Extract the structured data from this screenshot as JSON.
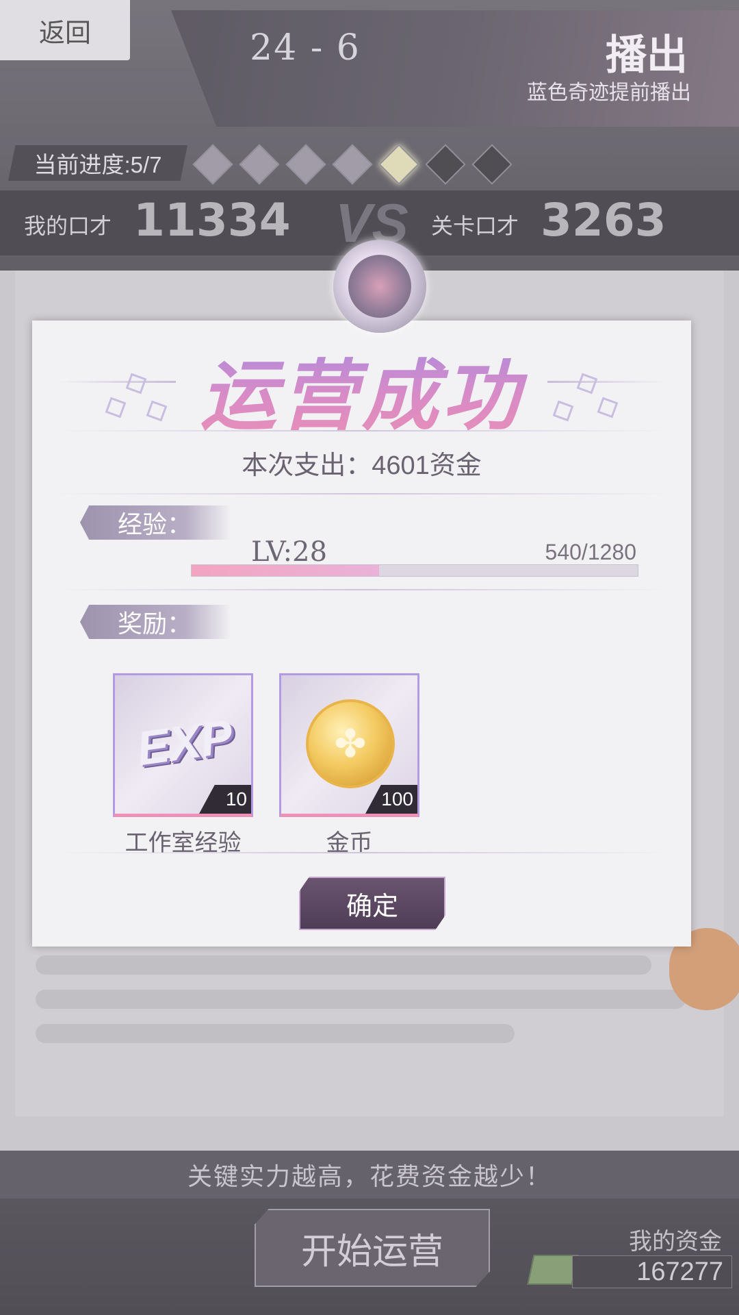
{
  "header": {
    "back_label": "返回",
    "stage": "24 - 6",
    "title": "播出",
    "subtitle": "蓝色奇迹提前播出",
    "progress_label": "当前进度:5/7",
    "progress": {
      "current": 5,
      "total": 7
    }
  },
  "versus": {
    "my_label": "我的口才",
    "my_value": "11334",
    "vs": "VS",
    "stage_label": "关卡口才",
    "stage_value": "3263"
  },
  "bottom": {
    "tip": "关键实力越高，花费资金越少！",
    "start_label": "开始运营",
    "funds_label": "我的资金",
    "funds_value": "167277"
  },
  "modal": {
    "title": "运营成功",
    "expense": "本次支出：4601资金",
    "exp_section": "经验：",
    "level": "LV:28",
    "exp_text": "540/1280",
    "exp_progress": 0.42,
    "reward_section": "奖励：",
    "rewards": [
      {
        "icon": "exp-icon",
        "count": "10",
        "name": "工作室经验",
        "icon_text": "EXP"
      },
      {
        "icon": "coin-icon",
        "count": "100",
        "name": "金币"
      }
    ],
    "confirm_label": "确定"
  },
  "colors": {
    "title_gradient": [
      "#a98be0",
      "#e98fb5"
    ],
    "exp_fill": "#f3a4c0",
    "reward_border": "#b39be3"
  }
}
